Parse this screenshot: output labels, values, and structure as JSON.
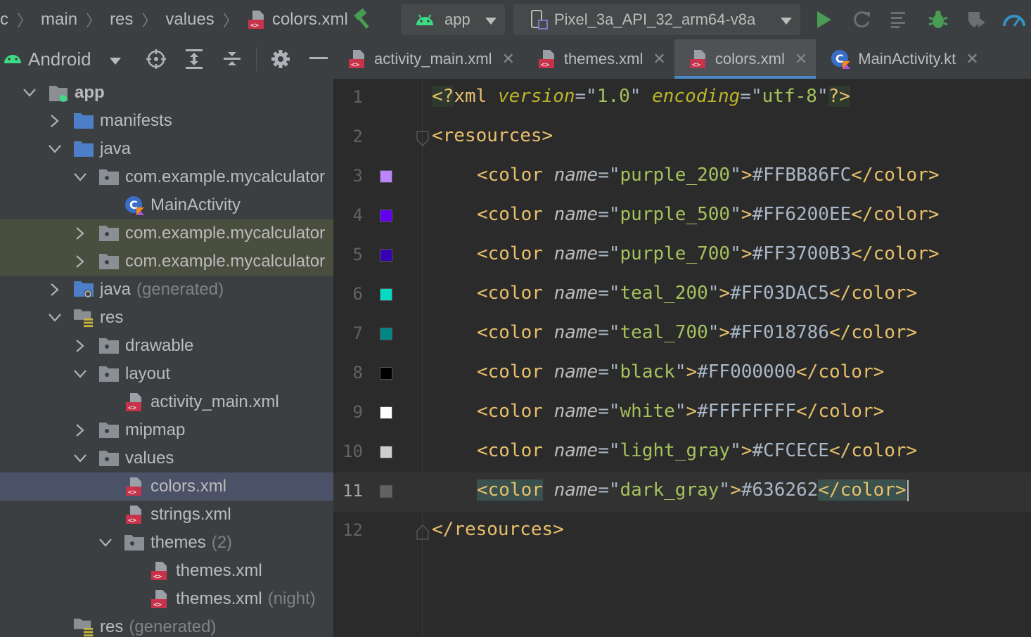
{
  "breadcrumb": {
    "items": [
      "rc",
      "main",
      "res",
      "values"
    ],
    "file": "colors.xml"
  },
  "toolbar": {
    "module_combo": "app",
    "device_combo": "Pixel_3a_API_32_arm64-v8a",
    "icons": [
      "hammer-icon",
      "android-icon",
      "device-icon",
      "run-icon",
      "rerun-icon",
      "logcat-icon",
      "debug-icon",
      "coverage-icon",
      "profiler-icon"
    ]
  },
  "project_panel": {
    "view_mode": "Android",
    "tools": [
      "locate-icon",
      "expand-all-icon",
      "collapse-all-icon",
      "gear-icon",
      "hide-icon"
    ],
    "tree": [
      {
        "label": "app",
        "suffix": "",
        "depth": 0,
        "expanded": true,
        "kind": "module"
      },
      {
        "label": "manifests",
        "suffix": "",
        "depth": 1,
        "expanded": false,
        "kind": "folder-blue"
      },
      {
        "label": "java",
        "suffix": "",
        "depth": 1,
        "expanded": true,
        "kind": "folder-blue"
      },
      {
        "label": "com.example.mycalculator",
        "suffix": "",
        "depth": 2,
        "expanded": true,
        "kind": "package"
      },
      {
        "label": "MainActivity",
        "suffix": "",
        "depth": 3,
        "expanded": null,
        "kind": "kotlin-class"
      },
      {
        "label": "com.example.mycalculator",
        "suffix": "",
        "depth": 2,
        "expanded": false,
        "kind": "package",
        "state": "highlight"
      },
      {
        "label": "com.example.mycalculator",
        "suffix": "",
        "depth": 2,
        "expanded": false,
        "kind": "package",
        "state": "highlight"
      },
      {
        "label": "java",
        "suffix": "(generated)",
        "depth": 1,
        "expanded": false,
        "kind": "folder-generated"
      },
      {
        "label": "res",
        "suffix": "",
        "depth": 1,
        "expanded": true,
        "kind": "res-folder"
      },
      {
        "label": "drawable",
        "suffix": "",
        "depth": 2,
        "expanded": false,
        "kind": "folder"
      },
      {
        "label": "layout",
        "suffix": "",
        "depth": 2,
        "expanded": true,
        "kind": "folder"
      },
      {
        "label": "activity_main.xml",
        "suffix": "",
        "depth": 3,
        "expanded": null,
        "kind": "xml"
      },
      {
        "label": "mipmap",
        "suffix": "",
        "depth": 2,
        "expanded": false,
        "kind": "folder"
      },
      {
        "label": "values",
        "suffix": "",
        "depth": 2,
        "expanded": true,
        "kind": "folder"
      },
      {
        "label": "colors.xml",
        "suffix": "",
        "depth": 3,
        "expanded": null,
        "kind": "xml",
        "state": "selected"
      },
      {
        "label": "strings.xml",
        "suffix": "",
        "depth": 3,
        "expanded": null,
        "kind": "xml"
      },
      {
        "label": "themes",
        "suffix": "(2)",
        "depth": 3,
        "expanded": true,
        "kind": "folder"
      },
      {
        "label": "themes.xml",
        "suffix": "",
        "depth": 4,
        "expanded": null,
        "kind": "xml"
      },
      {
        "label": "themes.xml",
        "suffix": "(night)",
        "depth": 4,
        "expanded": null,
        "kind": "xml"
      },
      {
        "label": "res",
        "suffix": "(generated)",
        "depth": 1,
        "expanded": null,
        "kind": "res-folder"
      }
    ]
  },
  "tabs": [
    {
      "label": "activity_main.xml",
      "kind": "xml",
      "active": false
    },
    {
      "label": "themes.xml",
      "kind": "xml",
      "active": false
    },
    {
      "label": "colors.xml",
      "kind": "xml",
      "active": true
    },
    {
      "label": "MainActivity.kt",
      "kind": "kotlin-class",
      "active": false
    }
  ],
  "editor": {
    "current_line": 11,
    "lines": [
      {
        "n": "1",
        "kind": "pi",
        "version": "1.0",
        "encoding": "utf-8"
      },
      {
        "n": "2",
        "kind": "open",
        "tag": "resources"
      },
      {
        "n": "3",
        "kind": "color",
        "name": "purple_200",
        "value": "#FFBB86FC",
        "swatch": "#BB86FC"
      },
      {
        "n": "4",
        "kind": "color",
        "name": "purple_500",
        "value": "#FF6200EE",
        "swatch": "#6200EE"
      },
      {
        "n": "5",
        "kind": "color",
        "name": "purple_700",
        "value": "#FF3700B3",
        "swatch": "#3700B3"
      },
      {
        "n": "6",
        "kind": "color",
        "name": "teal_200",
        "value": "#FF03DAC5",
        "swatch": "#03DAC5"
      },
      {
        "n": "7",
        "kind": "color",
        "name": "teal_700",
        "value": "#FF018786",
        "swatch": "#018786"
      },
      {
        "n": "8",
        "kind": "color",
        "name": "black",
        "value": "#FF000000",
        "swatch": "#000000"
      },
      {
        "n": "9",
        "kind": "color",
        "name": "white",
        "value": "#FFFFFFFF",
        "swatch": "#FFFFFF"
      },
      {
        "n": "10",
        "kind": "color",
        "name": "light_gray",
        "value": "#CFCECE",
        "swatch": "#CFCECE"
      },
      {
        "n": "11",
        "kind": "color",
        "name": "dark_gray",
        "value": "#636262",
        "swatch": "#636262"
      },
      {
        "n": "12",
        "kind": "close",
        "tag": "resources"
      }
    ]
  },
  "colors": {
    "accent": "#4a88c7",
    "selection": "#4b5166",
    "highlight": "#4a4e3f",
    "xml_icon": "#c7334a",
    "run_green": "#499c54"
  }
}
